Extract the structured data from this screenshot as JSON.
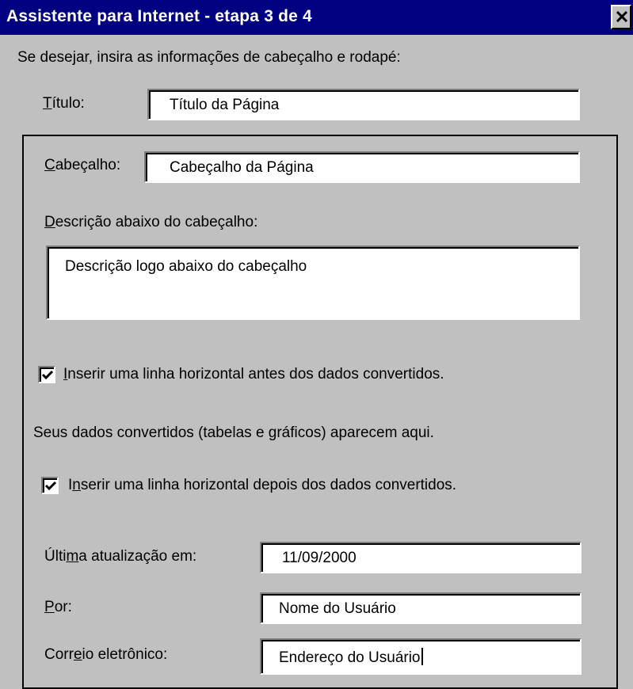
{
  "window": {
    "title": "Assistente para Internet - etapa 3 de 4",
    "close_icon": "close-icon"
  },
  "instructions": "Se desejar, insira as informações de cabeçalho e rodapé:",
  "titulo": {
    "label_pre": "",
    "label_key": "T",
    "label_post": "ítulo:",
    "value": "Título da Página"
  },
  "cabecalho": {
    "label_key": "C",
    "label_post": "abeçalho:",
    "value": "Cabeçalho da Página"
  },
  "descricao": {
    "label_key": "D",
    "label_post": "escrição abaixo do cabeçalho:",
    "value": "Descrição logo abaixo do cabeçalho"
  },
  "checkbox_before": {
    "checked": true,
    "label_key": "I",
    "label_post": "nserir uma linha horizontal antes dos dados convertidos."
  },
  "converted_note": "Seus dados convertidos (tabelas e gráficos) aparecem aqui.",
  "checkbox_after": {
    "checked": true,
    "label_pre": "I",
    "label_key": "n",
    "label_post": "serir uma linha horizontal depois dos dados convertidos."
  },
  "ultima": {
    "label_pre": "Últi",
    "label_key": "m",
    "label_post": "a atualização em:",
    "value": "11/09/2000"
  },
  "por": {
    "label_key": "P",
    "label_post": "or:",
    "value": "Nome do Usuário"
  },
  "correio": {
    "label_pre": "Corr",
    "label_key": "e",
    "label_post": "io eletrônico:",
    "value": "Endereço do Usuário"
  }
}
